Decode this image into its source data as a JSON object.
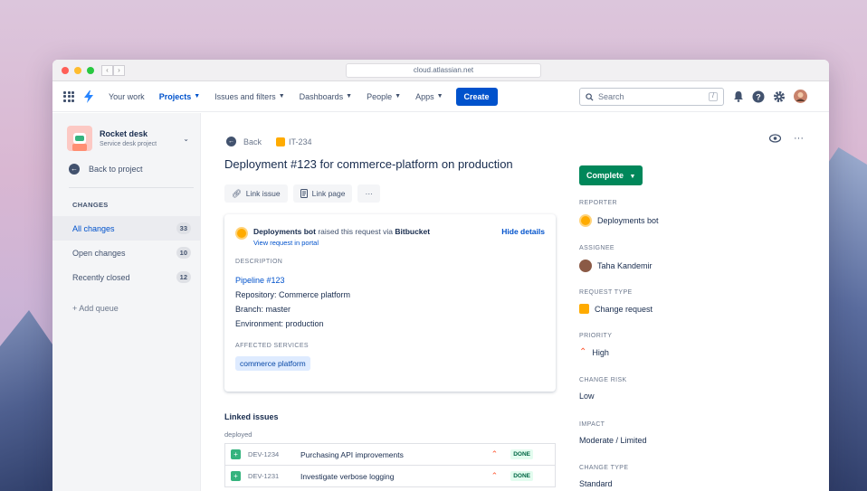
{
  "browser": {
    "url": "cloud.atlassian.net"
  },
  "topnav": {
    "items": [
      {
        "label": "Your work",
        "caret": false,
        "active": false
      },
      {
        "label": "Projects",
        "caret": true,
        "active": true
      },
      {
        "label": "Issues and filters",
        "caret": true,
        "active": false
      },
      {
        "label": "Dashboards",
        "caret": true,
        "active": false
      },
      {
        "label": "People",
        "caret": true,
        "active": false
      },
      {
        "label": "Apps",
        "caret": true,
        "active": false
      }
    ],
    "create_label": "Create",
    "search_placeholder": "Search",
    "search_shortcut": "/"
  },
  "sidebar": {
    "project_name": "Rocket desk",
    "project_type": "Service desk project",
    "back_label": "Back to project",
    "section_label": "CHANGES",
    "queues": [
      {
        "label": "All changes",
        "count": "33",
        "active": true
      },
      {
        "label": "Open changes",
        "count": "10",
        "active": false
      },
      {
        "label": "Recently closed",
        "count": "12",
        "active": false
      }
    ],
    "add_queue_label": "+ Add queue"
  },
  "issue": {
    "back_label": "Back",
    "key": "IT-234",
    "title": "Deployment #123 for commerce-platform on production",
    "actions": {
      "link_issue": "Link issue",
      "link_page": "Link page",
      "more": "···"
    },
    "card": {
      "reporter_name": "Deployments bot",
      "raised_via_text": " raised this request via ",
      "source": "Bitbucket",
      "portal_link": "View request in portal",
      "hide_details": "Hide details",
      "description_label": "DESCRIPTION",
      "description": {
        "pipeline": "Pipeline #123",
        "repository": "Repository: Commerce platform",
        "branch": "Branch: master",
        "environment": "Environment: production"
      },
      "affected_label": "AFFECTED SERVICES",
      "affected_service": "commerce platform"
    },
    "linked": {
      "title": "Linked issues",
      "relation": "deployed",
      "rows": [
        {
          "key": "DEV-1234",
          "summary": "Purchasing API improvements",
          "status": "DONE"
        },
        {
          "key": "DEV-1231",
          "summary": "Investigate verbose logging",
          "status": "DONE"
        }
      ]
    }
  },
  "details": {
    "status_label": "Complete",
    "fields": [
      {
        "label": "REPORTER",
        "value": "Deployments bot"
      },
      {
        "label": "ASSIGNEE",
        "value": "Taha Kandemir"
      },
      {
        "label": "REQUEST TYPE",
        "value": "Change request"
      },
      {
        "label": "PRIORITY",
        "value": "High"
      },
      {
        "label": "CHANGE RISK",
        "value": "Low"
      },
      {
        "label": "IMPACT",
        "value": "Moderate / Limited"
      },
      {
        "label": "CHANGE TYPE",
        "value": "Standard"
      }
    ]
  },
  "colors": {
    "brand_blue": "#0052cc",
    "status_green": "#00875a",
    "priority_red": "#ff5630",
    "request_yellow": "#ffab00"
  }
}
